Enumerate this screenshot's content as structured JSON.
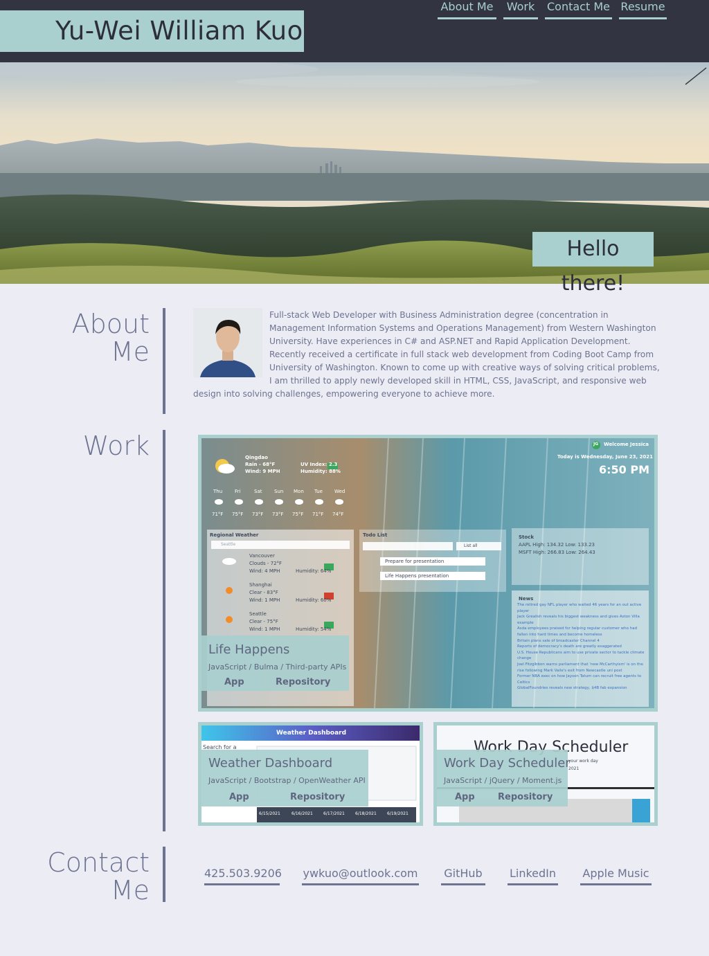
{
  "header": {
    "name": "Yu-Wei William Kuo",
    "nav": [
      "About Me",
      "Work",
      "Contact Me",
      "Resume"
    ]
  },
  "hero": {
    "greeting": "Hello there!"
  },
  "about": {
    "title_line1": "About",
    "title_line2": "Me",
    "bio": "Full-stack Web Developer with Business Administration degree (concentration in Management Information Systems and Operations Management) from Western Washington University. Have experiences in C# and ASP.NET and Rapid Application Development. Recently received a certificate in full stack web development from Coding Boot Camp from University of Washington. Known to come up with creative ways of solving critical problems, I am thrilled to apply newly developed skill in HTML, CSS, JavaScript, and responsive web design into solving challenges, empowering everyone to achieve more."
  },
  "work": {
    "title": "Work",
    "projects": [
      {
        "title": "Life Happens",
        "stack": "JavaScript / Bulma / Third-party APIs",
        "app_label": "App",
        "repo_label": "Repository",
        "preview": {
          "welcome": "Welcome Jessica",
          "avatar_initials": "JG",
          "date": "Today is Wednesday, June 23, 2021",
          "time": "6:50 PM",
          "city": "Qingdao",
          "rain": "Rain - 68°F",
          "wind": "Wind: 9 MPH",
          "uv": "UV Index:",
          "uv_value": "2.3",
          "humidity": "Humidity: 88%",
          "forecast_days": [
            "Thu",
            "Fri",
            "Sat",
            "Sun",
            "Mon",
            "Tue",
            "Wed"
          ],
          "forecast_temps": [
            "71°F",
            "75°F",
            "73°F",
            "73°F",
            "75°F",
            "71°F",
            "74°F"
          ],
          "regional_title": "Regional Weather",
          "search_placeholder": "Seattle",
          "regional": [
            {
              "city": "Vancouver",
              "cond": "Clouds - 72°F",
              "wind": "Wind: 4 MPH",
              "humidity": "Humidity: 64%"
            },
            {
              "city": "Shanghai",
              "cond": "Clear - 83°F",
              "wind": "Wind: 1 MPH",
              "humidity": "Humidity: 60%"
            },
            {
              "city": "Seattle",
              "cond": "Clear - 75°F",
              "wind": "Wind: 1 MPH",
              "humidity": "Humidity: 54%"
            }
          ],
          "todo_title": "Todo List",
          "todo_filter": "List all",
          "todos": [
            "Prepare for presentation",
            "Life Happens presentation"
          ],
          "stock_title": "Stock",
          "stocks": [
            "AAPL High: 134.32 Low: 133.23",
            "MSFT High: 266.83 Low: 264.43"
          ],
          "news_title": "News",
          "news": [
            "The retired gay NFL player who waited 46 years for an out active player",
            "Jack Grealish reveals his biggest weakness and gives Aston Villa example",
            "Asda employees praised for helping regular customer who had fallen into hard times and become homeless",
            "Britain plans sale of broadcaster Channel 4",
            "Reports of democracy's death are greatly exaggerated",
            "U.S. House Republicans aim to use private sector to tackle climate change",
            "Joel Fitzgibbon warns parliament that 'new McCarthyism' is on the rise following Mark Vaile's exit from Newcastle uni post",
            "Former NBA exec on how Jayson Tatum can recruit free agents to Celtics",
            "GlobalFoundries reveals new strategy, $4B fab expansion"
          ]
        }
      },
      {
        "title": "Weather Dashboard",
        "stack": "JavaScript / Bootstrap / OpenWeather API",
        "app_label": "App",
        "repo_label": "Repository",
        "preview": {
          "banner": "Weather Dashboard",
          "search_label": "Search for a",
          "dates": [
            "6/15/2021",
            "6/16/2021",
            "6/17/2021",
            "6/18/2021",
            "6/19/2021"
          ]
        }
      },
      {
        "title": "Work Day Scheduler",
        "stack": "JavaScript / jQuery / Moment.js",
        "app_label": "App",
        "repo_label": "Repository",
        "preview": {
          "heading": "Work Day Scheduler",
          "sub": "your work day",
          "year": "2021"
        }
      }
    ]
  },
  "contact": {
    "title_line1": "Contact",
    "title_line2": "Me",
    "links": [
      "425.503.9206",
      "ywkuo@outlook.com",
      "GitHub",
      "LinkedIn",
      "Apple Music"
    ]
  },
  "colors": {
    "header_bg": "#323541",
    "accent": "#a9cfcf",
    "page_bg": "#ebecf4",
    "text": "#6d7390"
  }
}
